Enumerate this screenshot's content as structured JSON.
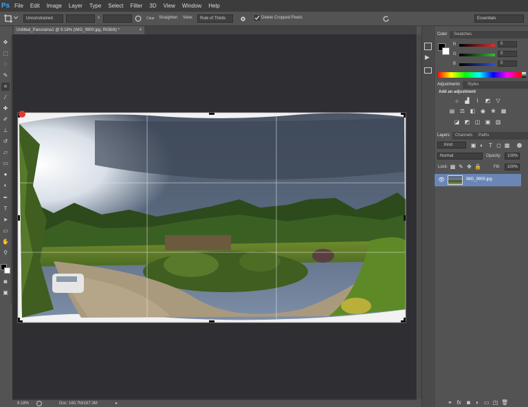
{
  "app": {
    "logo": "Ps"
  },
  "menu": [
    "File",
    "Edit",
    "Image",
    "Layer",
    "Type",
    "Select",
    "Filter",
    "3D",
    "View",
    "Window",
    "Help"
  ],
  "options": {
    "ratio_preset": "Unconstrained",
    "width_value": "",
    "height_value": "",
    "swap_symbol": "x",
    "straighten_label": "Straighten",
    "view_label": "View:",
    "view_value": "Rule of Thirds",
    "delete_cropped_label": "Delete Cropped Pixels",
    "delete_cropped_checked": true,
    "workspace": "Essentials"
  },
  "document": {
    "tab_title": "Untitled_Panorama1 @ 9.18% (IMG_9900.jpg, RGB/8) *",
    "close_symbol": "×"
  },
  "status": {
    "zoom": "9.18%",
    "doc_info": "Doc: 160.7M/167.3M"
  },
  "color_panel": {
    "tabs": [
      "Color",
      "Swatches"
    ],
    "channels": [
      {
        "label": "R",
        "value": "0",
        "color": "#e03030"
      },
      {
        "label": "G",
        "value": "0",
        "color": "#30c030"
      },
      {
        "label": "B",
        "value": "0",
        "color": "#3050e0"
      }
    ]
  },
  "adjustments_panel": {
    "tabs": [
      "Adjustments",
      "Styles"
    ],
    "heading": "Add an adjustment"
  },
  "layers_panel": {
    "tabs": [
      "Layers",
      "Channels",
      "Paths"
    ],
    "filter_kind": "Kind",
    "blend_mode": "Normal",
    "opacity_label": "Opacity:",
    "opacity_value": "100%",
    "lock_label": "Lock:",
    "fill_label": "Fill:",
    "fill_value": "100%",
    "layers": [
      {
        "name": "IMG_9900.jpg",
        "visible": true,
        "selected": true
      }
    ]
  },
  "colors": {
    "accent_selected_layer": "#6b86b5",
    "foreground": "#000000",
    "background": "#ffffff"
  }
}
